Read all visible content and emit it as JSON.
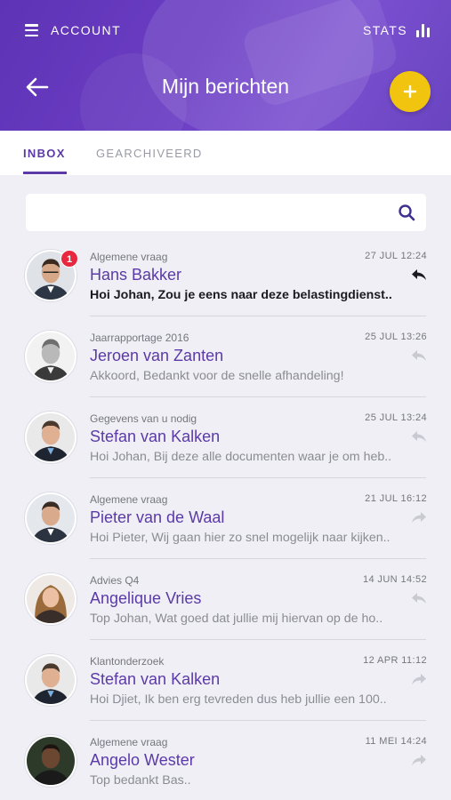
{
  "header": {
    "menu_label": "ACCOUNT",
    "stats_label": "STATS",
    "title": "Mijn berichten",
    "accent_color": "#5e33b5",
    "add_button_color": "#f1c40f"
  },
  "tabs": [
    {
      "label": "INBOX",
      "active": true
    },
    {
      "label": "GEARCHIVEERD",
      "active": false
    }
  ],
  "search": {
    "placeholder": ""
  },
  "messages": [
    {
      "subject": "Algemene vraag",
      "date": "27 JUL 12:24",
      "sender": "Hans Bakker",
      "preview": "Hoi Johan, Zou je eens naar deze belastingdienst..",
      "unread": true,
      "badge": "1",
      "action_icon": "reply-icon"
    },
    {
      "subject": "Jaarrapportage 2016",
      "date": "25 JUL 13:26",
      "sender": "Jeroen van Zanten",
      "preview": "Akkoord, Bedankt voor de snelle afhandeling!",
      "unread": false,
      "badge": "",
      "action_icon": "reply-icon"
    },
    {
      "subject": "Gegevens van u nodig",
      "date": "25 JUL 13:24",
      "sender": "Stefan van Kalken",
      "preview": "Hoi Johan, Bij deze alle documenten waar je om heb..",
      "unread": false,
      "badge": "",
      "action_icon": "reply-icon"
    },
    {
      "subject": "Algemene vraag",
      "date": "21 JUL 16:12",
      "sender": "Pieter van de Waal",
      "preview": "Hoi Pieter, Wij gaan hier zo snel mogelijk naar kijken..",
      "unread": false,
      "badge": "",
      "action_icon": "forward-icon"
    },
    {
      "subject": "Advies Q4",
      "date": "14 JUN 14:52",
      "sender": "Angelique Vries",
      "preview": "Top Johan, Wat goed dat jullie mij hiervan op de ho..",
      "unread": false,
      "badge": "",
      "action_icon": "reply-icon"
    },
    {
      "subject": "Klantonderzoek",
      "date": "12 APR 11:12",
      "sender": "Stefan van Kalken",
      "preview": "Hoi Djiet, Ik ben erg tevreden dus heb jullie een 100..",
      "unread": false,
      "badge": "",
      "action_icon": "forward-icon"
    },
    {
      "subject": "Algemene vraag",
      "date": "11 MEI 14:24",
      "sender": "Angelo Wester",
      "preview": "Top bedankt Bas..",
      "unread": false,
      "badge": "",
      "action_icon": "forward-icon"
    }
  ]
}
